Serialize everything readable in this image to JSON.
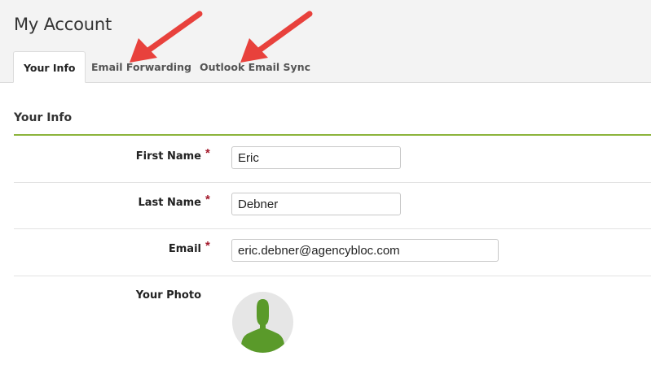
{
  "page": {
    "title": "My Account"
  },
  "tabs": [
    {
      "label": "Your Info",
      "active": true
    },
    {
      "label": "Email Forwarding",
      "active": false
    },
    {
      "label": "Outlook Email Sync",
      "active": false
    }
  ],
  "section": {
    "title": "Your Info"
  },
  "form": {
    "first_name": {
      "label": "First Name",
      "value": "Eric",
      "required": true
    },
    "last_name": {
      "label": "Last Name",
      "value": "Debner",
      "required": true
    },
    "email": {
      "label": "Email",
      "value": "eric.debner@agencybloc.com",
      "required": true
    },
    "photo": {
      "label": "Your Photo",
      "icon": "user-silhouette-icon"
    },
    "required_marker": "*"
  },
  "colors": {
    "accent_green": "#8cb43c",
    "avatar_green": "#5a9a2a",
    "required_red": "#a3192b",
    "annotation_arrow": "#e8413c"
  }
}
